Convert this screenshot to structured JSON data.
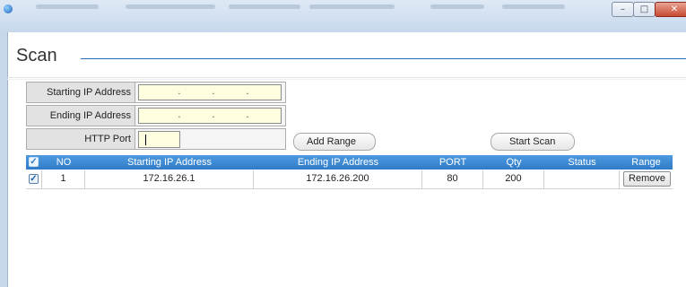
{
  "page": {
    "title": "Scan"
  },
  "form": {
    "start_ip_label": "Starting IP Address",
    "end_ip_label": "Ending IP Address",
    "http_port_label": "HTTP Port",
    "ip_separator": "."
  },
  "buttons": {
    "add_range": "Add Range",
    "start_scan": "Start Scan"
  },
  "table": {
    "headers": {
      "no": "NO",
      "start_ip": "Starting IP Address",
      "end_ip": "Ending IP Address",
      "port": "PORT",
      "qty": "Qty",
      "status": "Status",
      "range": "Range"
    },
    "rows": [
      {
        "checked": true,
        "no": "1",
        "start_ip": "172.16.26.1",
        "end_ip": "172.16.26.200",
        "port": "80",
        "qty": "200",
        "status": "",
        "action": "Remove"
      }
    ]
  },
  "colors": {
    "header_blue": "#2f7bc8",
    "input_yellow": "#fffde0",
    "title_underline": "#2a6ebb"
  }
}
